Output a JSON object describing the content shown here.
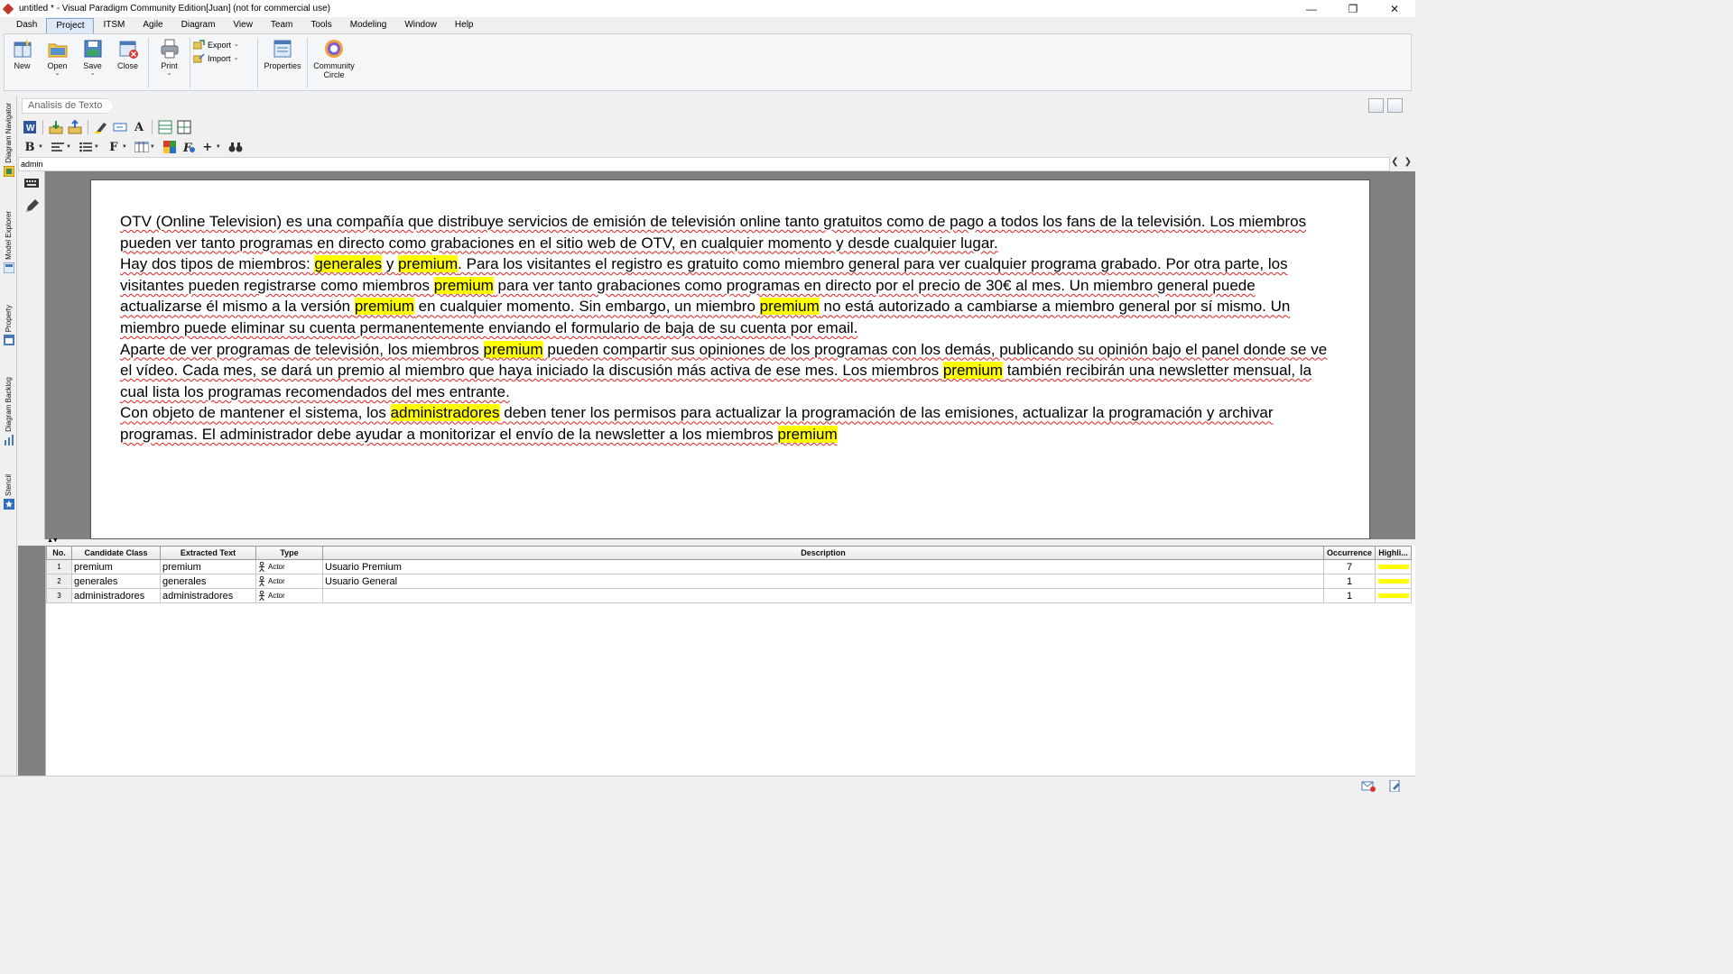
{
  "window": {
    "title": "untitled * - Visual Paradigm Community Edition[Juan] (not for commercial use)",
    "controls": [
      "—",
      "❐",
      "✕"
    ]
  },
  "menu": {
    "tabs": [
      "Dash",
      "Project",
      "ITSM",
      "Agile",
      "Diagram",
      "View",
      "Team",
      "Tools",
      "Modeling",
      "Window",
      "Help"
    ],
    "active": "Project"
  },
  "ribbon": {
    "new_label": "New",
    "open_label": "Open",
    "save_label": "Save",
    "close_label": "Close",
    "print_label": "Print",
    "export_label": "Export",
    "import_label": "Import",
    "properties_label": "Properties",
    "community_label_1": "Community",
    "community_label_2": "Circle"
  },
  "sidebar": {
    "tabs": [
      "Diagram Navigator",
      "Model Explorer",
      "Property",
      "Diagram Backlog",
      "Stencil"
    ]
  },
  "editor": {
    "breadcrumb": "Analisis de Texto",
    "admin_field": "admin"
  },
  "document": {
    "p1": {
      "a": "OTV (Online Television) es una compañía que distribuye servicios de emisión de televisión online tanto gratuitos como de pago a todos los fans de la televisión. Los miembros pueden ver tanto programas en directo como grabaciones en el sitio web de OTV, en cualquier momento y desde cualquier lugar."
    },
    "p2": {
      "a": "Hay dos tipos de miembros: ",
      "h1": "generales",
      "b": " y ",
      "h2": "premium",
      "c": ". Para los visitantes el registro es gratuito como miembro general para ver cualquier programa grabado. Por otra parte, los visitantes pueden registrarse como miembros ",
      "h3": "premium",
      "d": " para ver tanto grabaciones como programas en directo por el precio de 30€ al mes. Un miembro general puede actualizarse él mismo a la versión ",
      "h4": "premium",
      "e": " en cualquier momento. Sin embargo, un miembro ",
      "h5": "premium",
      "f": " no está autorizado a cambiarse a miembro general por sí mismo. Un miembro puede eliminar su cuenta permanentemente enviando el formulario de baja de su cuenta por email."
    },
    "p3": {
      "a": "Aparte de ver programas de televisión, los miembros ",
      "h1": "premium",
      "b": " pueden compartir sus opiniones de los programas con los demás, publicando su opinión bajo el panel donde se ve el vídeo. Cada mes, se dará un premio al miembro que haya iniciado la discusión más activa de ese mes. Los miembros ",
      "h2": "premium",
      "c": " también recibirán una newsletter mensual, la cual lista los programas recomendados del mes entrante."
    },
    "p4": {
      "a": "Con objeto de mantener el sistema, los ",
      "h1": "administradores",
      "b": " deben tener los permisos para actualizar la programación de las emisiones, actualizar la programación y archivar programas. El administrador debe ayudar a monitorizar el envío de la newsletter a los miembros ",
      "h2": "premium"
    },
    "highlight_color": "#ffff00"
  },
  "table": {
    "headers": [
      "No.",
      "Candidate Class",
      "Extracted Text",
      "Type",
      "Description",
      "Occurrence",
      "Highli..."
    ],
    "rows": [
      {
        "no": "1",
        "candidate": "premium",
        "extracted": "premium",
        "type": "Actor",
        "description": "Usuario Premium",
        "occurrence": "7"
      },
      {
        "no": "2",
        "candidate": "generales",
        "extracted": "generales",
        "type": "Actor",
        "description": "Usuario General",
        "occurrence": "1"
      },
      {
        "no": "3",
        "candidate": "administradores",
        "extracted": "administradores",
        "type": "Actor",
        "description": "",
        "occurrence": "1"
      }
    ]
  }
}
